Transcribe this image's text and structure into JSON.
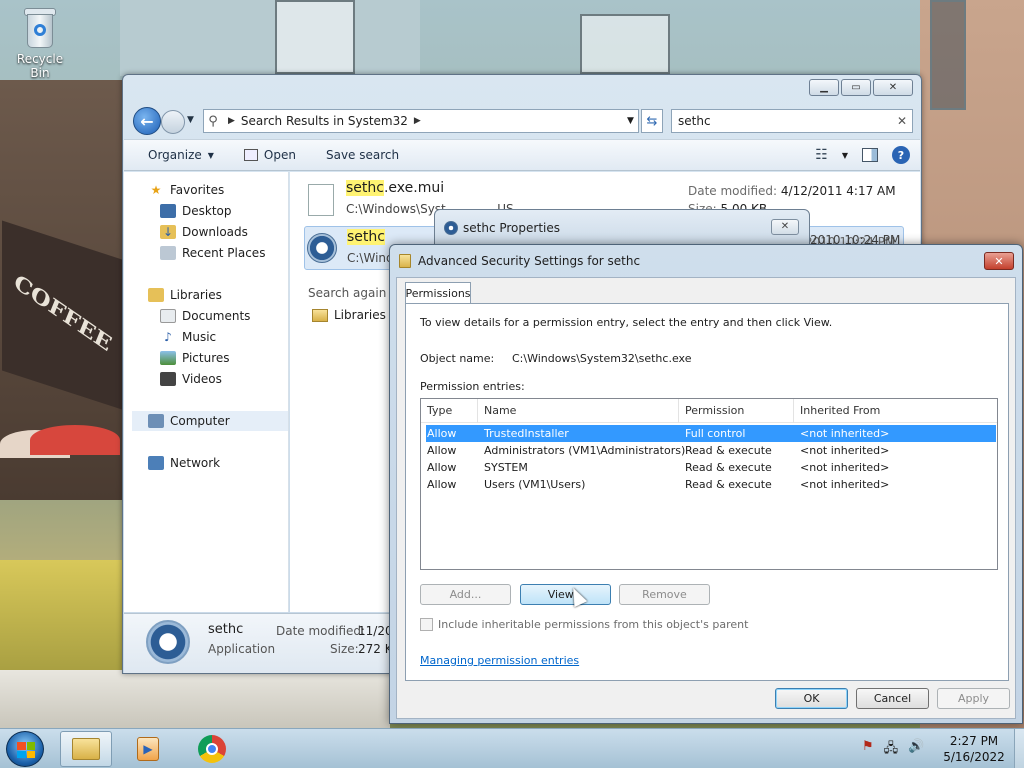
{
  "desktop": {
    "icons": [
      {
        "label": "Recycle Bin",
        "icon": "recycle-bin-icon"
      }
    ],
    "wallpaper_text": "COFFEE"
  },
  "explorer": {
    "address": {
      "crumbs": [
        "Search Results in System32"
      ]
    },
    "search": {
      "value": "sethc"
    },
    "toolbar": {
      "organize": "Organize",
      "open": "Open",
      "save_search": "Save search"
    },
    "navpane": {
      "favorites": {
        "label": "Favorites",
        "items": [
          "Desktop",
          "Downloads",
          "Recent Places"
        ]
      },
      "libraries": {
        "label": "Libraries",
        "items": [
          "Documents",
          "Music",
          "Pictures",
          "Videos"
        ]
      },
      "computer": "Computer",
      "network": "Network"
    },
    "results": [
      {
        "name_hl": "sethc",
        "name_rest": ".exe.mui",
        "path": "C:\\Windows\\Syst",
        "path_tail": "...US",
        "date_label": "Date modified:",
        "date": "4/12/2011 4:17 AM",
        "size_label": "Size:",
        "size": "5.00 KB"
      },
      {
        "name_hl": "sethc",
        "name_rest": "",
        "path": "C:\\Wind",
        "date_label": "",
        "date": "2010 10:24 PM"
      }
    ],
    "search_again": "Search again in:",
    "search_again_items": [
      "Libraries"
    ],
    "details": {
      "name": "sethc",
      "type": "Application",
      "date_label": "Date modified:",
      "date": "11/20/",
      "size_label": "Size:",
      "size": "272 KB"
    }
  },
  "properties": {
    "title": "sethc Properties",
    "close": "✕"
  },
  "advanced": {
    "title": "Advanced Security Settings for sethc",
    "close": "✕",
    "tab": "Permissions",
    "instructions": "To view details for a permission entry, select the entry and then click View.",
    "object_label": "Object name:",
    "object_value": "C:\\Windows\\System32\\sethc.exe",
    "entries_label": "Permission entries:",
    "columns": [
      "Type",
      "Name",
      "Permission",
      "Inherited From"
    ],
    "rows": [
      {
        "type": "Allow",
        "name": "TrustedInstaller",
        "permission": "Full control",
        "inherited": "<not inherited>"
      },
      {
        "type": "Allow",
        "name": "Administrators (VM1\\Administrators)",
        "permission": "Read & execute",
        "inherited": "<not inherited>"
      },
      {
        "type": "Allow",
        "name": "SYSTEM",
        "permission": "Read & execute",
        "inherited": "<not inherited>"
      },
      {
        "type": "Allow",
        "name": "Users (VM1\\Users)",
        "permission": "Read & execute",
        "inherited": "<not inherited>"
      }
    ],
    "buttons": {
      "add": "Add...",
      "view": "View...",
      "remove": "Remove",
      "ok": "OK",
      "cancel": "Cancel",
      "apply": "Apply"
    },
    "include_inherit": "Include inheritable permissions from this object's parent",
    "link": "Managing permission entries"
  },
  "taskbar": {
    "clock_time": "2:27 PM",
    "clock_date": "5/16/2022"
  }
}
